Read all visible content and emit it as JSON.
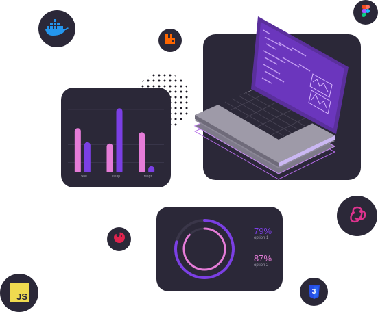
{
  "bar_chart": {
    "chart_data": {
      "type": "bar",
      "categories": [
        "Янв",
        "Февр",
        "Март"
      ],
      "series": [
        {
          "values": [
            62,
            40,
            56
          ],
          "color": "#e57cd8"
        },
        {
          "values": [
            42,
            90,
            8
          ],
          "color": "#7b3fe4"
        }
      ],
      "ylim": [
        0,
        100
      ],
      "grid": true
    }
  },
  "ring_chart": {
    "items": [
      {
        "value": 79,
        "value_text": "79%",
        "label": "option 1",
        "color": "#7b3fe4"
      },
      {
        "value": 87,
        "value_text": "87%",
        "label": "option 2",
        "color": "#e57cd8"
      }
    ]
  },
  "icons": {
    "docker": "docker-icon",
    "rabbitmq": "rabbitmq-icon",
    "figma": "figma-icon",
    "redux": "redux-icon",
    "nestjs": "nestjs-icon",
    "javascript": "javascript-icon",
    "javascript_text": "JS",
    "css3": "css3-icon",
    "css3_text": "3"
  },
  "colors": {
    "card": "#2b2838",
    "purple": "#7b3fe4",
    "pink": "#e57cd8",
    "js_yellow": "#f0db4f",
    "css_blue": "#264de4"
  }
}
